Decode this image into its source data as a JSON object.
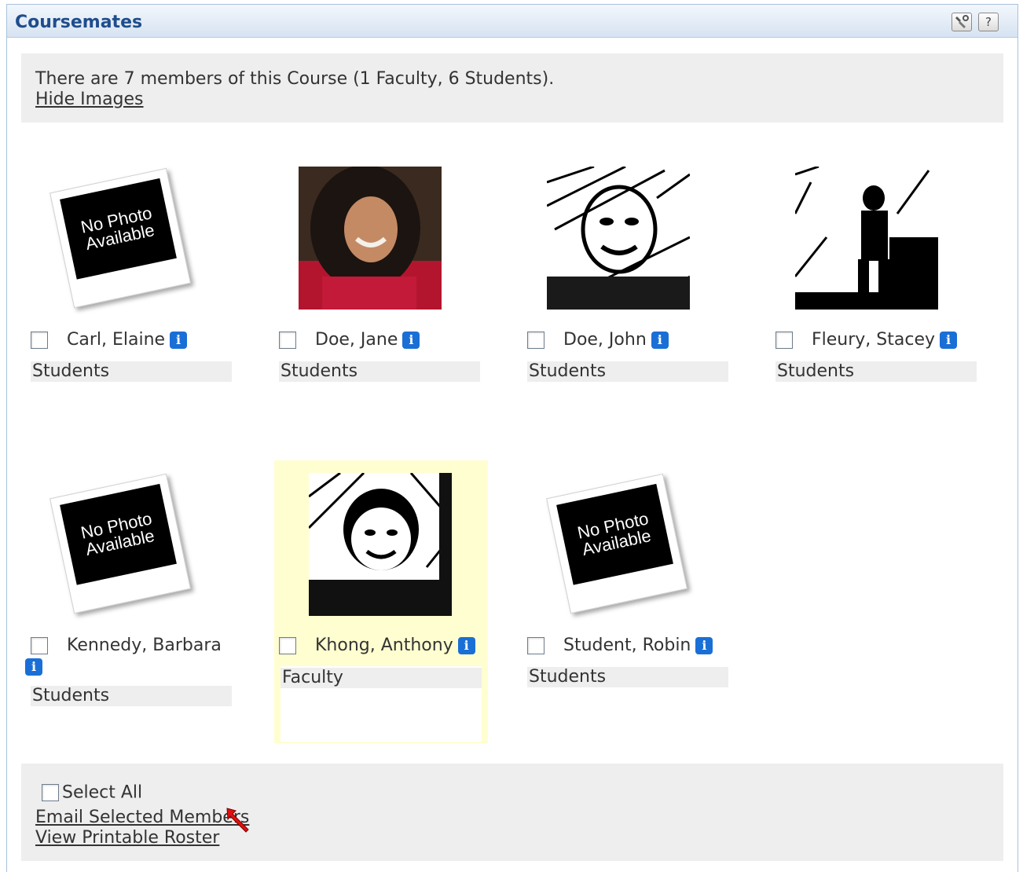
{
  "header": {
    "title": "Coursemates",
    "tools_icon": "wrench-tools-icon",
    "help_label": "?"
  },
  "summary": {
    "text": "There are 7 members of this Course (1 Faculty, 6 Students).",
    "hide_images_link": "Hide Images"
  },
  "members": [
    {
      "name": "Carl, Elaine",
      "role": "Students",
      "photo": "no-photo"
    },
    {
      "name": "Doe, Jane",
      "role": "Students",
      "photo": "photo"
    },
    {
      "name": "Doe, John",
      "role": "Students",
      "photo": "photo"
    },
    {
      "name": "Fleury, Stacey",
      "role": "Students",
      "photo": "photo"
    },
    {
      "name": "Kennedy, Barbara",
      "role": "Students",
      "photo": "no-photo"
    },
    {
      "name": "Khong, Anthony",
      "role": "Faculty",
      "photo": "photo",
      "highlighted": true
    },
    {
      "name": "Student, Robin",
      "role": "Students",
      "photo": "no-photo"
    }
  ],
  "no_photo_label_line1": "No Photo",
  "no_photo_label_line2": "Available",
  "info_icon_glyph": "i",
  "footer": {
    "select_all_label": "Select All",
    "email_link": "Email Selected Members",
    "roster_link": "View Printable Roster"
  },
  "colors": {
    "title": "#1f4d8c",
    "highlight": "#fffed0",
    "panel_gray": "#eeeeee",
    "info_blue": "#1a6fd6"
  }
}
